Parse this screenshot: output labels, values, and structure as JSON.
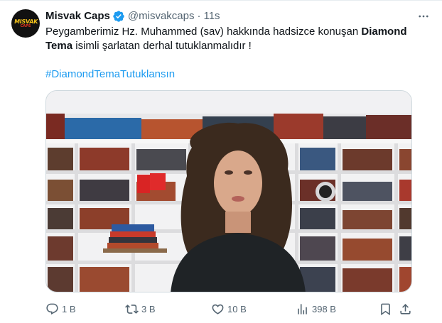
{
  "author": {
    "name": "Misvak Caps",
    "handle": "@misvakcaps",
    "time": "11s",
    "avatar_logo_top": "MISVAK",
    "avatar_logo_bottom": "CAPS",
    "verified_color": "#1d9bf0"
  },
  "tweet": {
    "text_part1": "Peygamberimiz Hz. Muhammed (sav) hakkında hadsizce konuşan ",
    "text_bold_1": "Diamond",
    "text_bold_2": "Tema",
    "text_part2": " isimli şarlatan derhal tutuklanmalıdır !",
    "hashtag": "#DiamondTemaTutuklansın"
  },
  "media": {
    "description_icon": "video-frame"
  },
  "actions": {
    "replies": "1 B",
    "retweets": "3 B",
    "likes": "10 B",
    "views": "398 B"
  },
  "colors": {
    "link": "#1d9bf0",
    "muted": "#536471",
    "text": "#0f1419"
  }
}
